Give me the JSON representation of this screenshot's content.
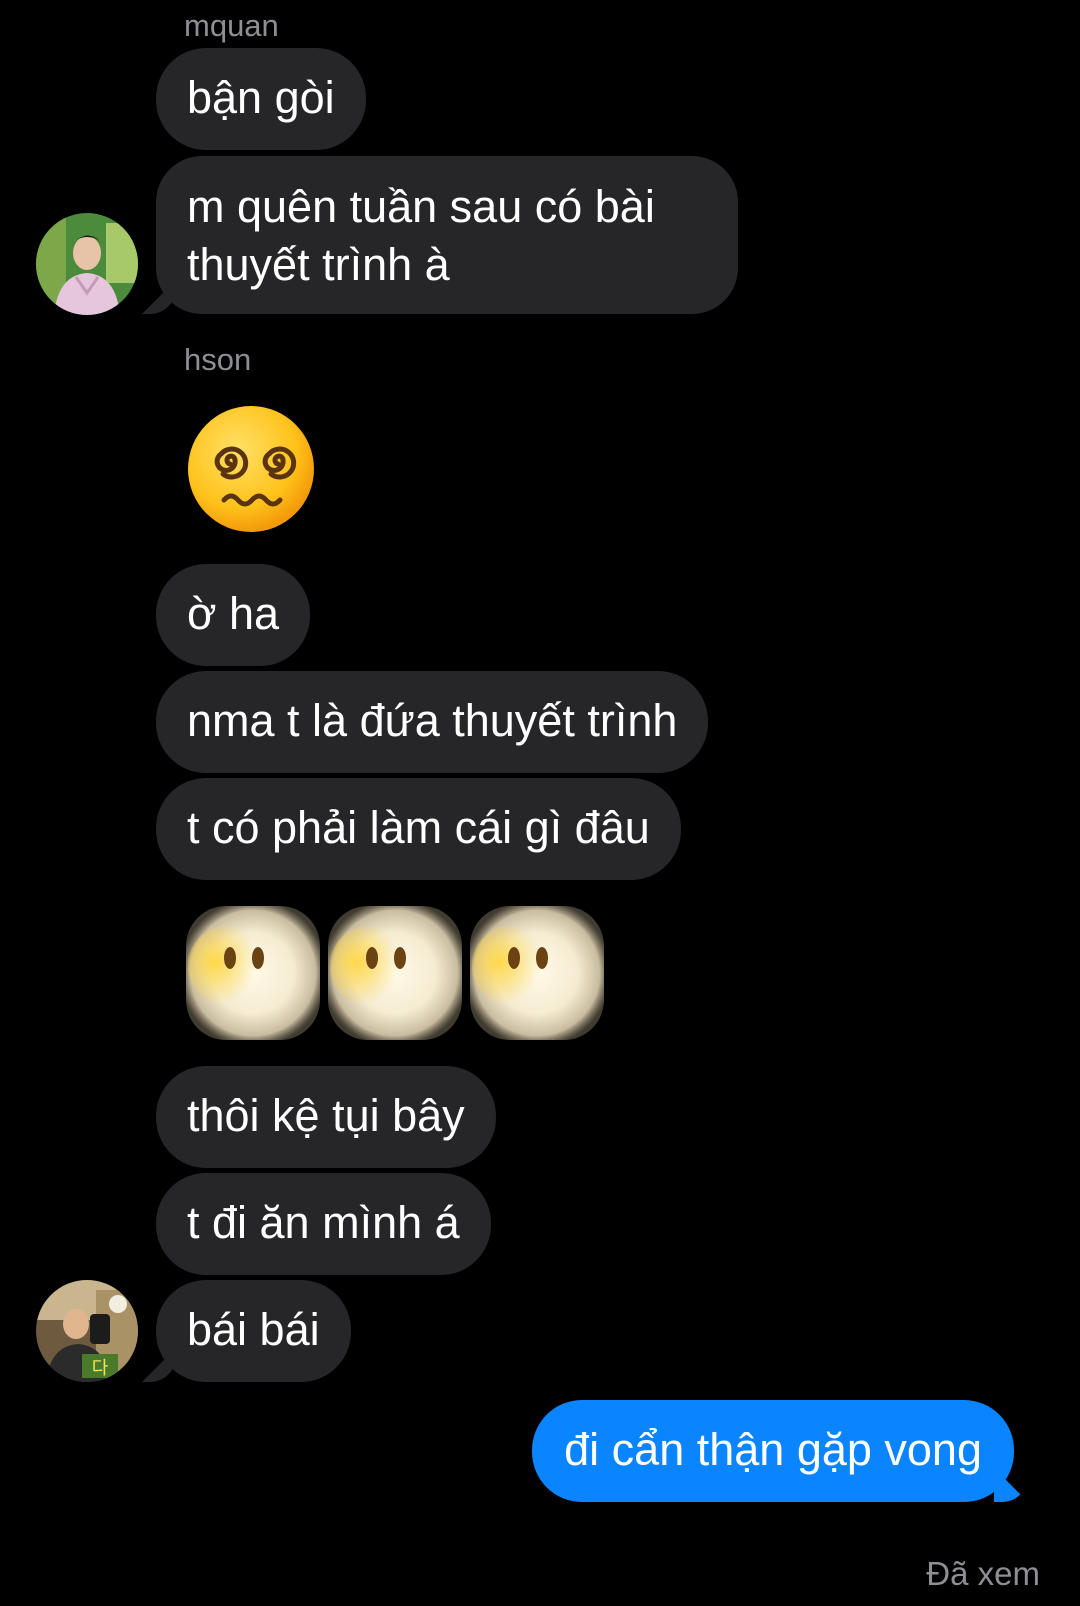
{
  "conversation": {
    "sender_1": "mquan",
    "sender_2": "hson",
    "messages": [
      "bận gòi",
      "m quên tuần sau có bài thuyết trình à",
      "ờ ha",
      "nma t là đứa thuyết trình",
      "t có phải làm cái gì đâu",
      "thôi kệ tụi bây",
      "t đi ăn mình á",
      "bái bái",
      "đi cẩn thận gặp vong"
    ],
    "emoji_1": "face-with-spiral-eyes",
    "emoji_2": "face-in-clouds",
    "read_receipt": "Đã xem"
  },
  "colors": {
    "background": "#000000",
    "incoming_bubble": "#262628",
    "outgoing_bubble": "#0a84ff",
    "meta_text": "#8e8e93"
  }
}
